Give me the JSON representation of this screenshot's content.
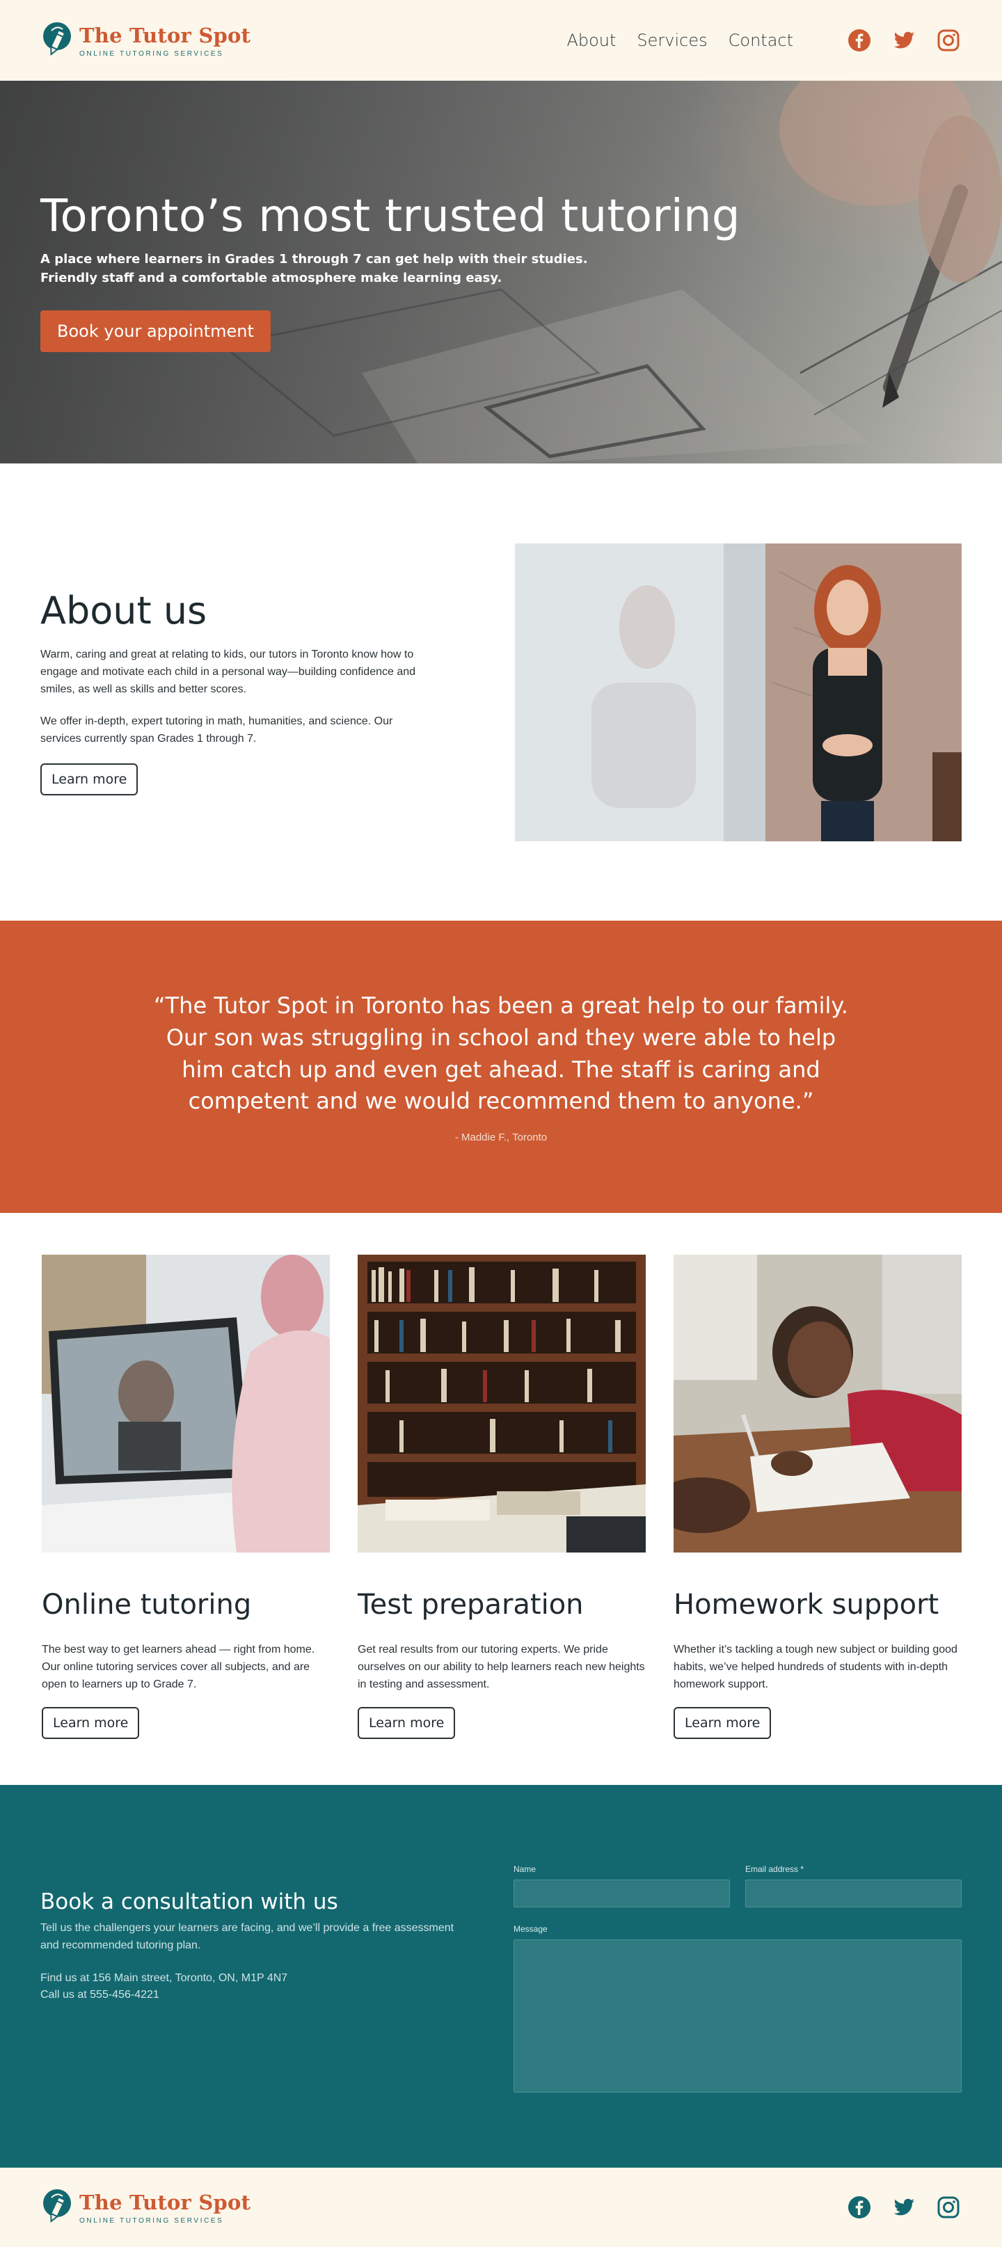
{
  "brand": {
    "name": "The Tutor Spot",
    "tagline": "ONLINE TUTORING SERVICES"
  },
  "nav": {
    "items": [
      "About",
      "Services",
      "Contact"
    ]
  },
  "social": [
    "facebook-icon",
    "twitter-icon",
    "instagram-icon"
  ],
  "colors": {
    "accent": "#cd5a33",
    "teal": "#136870",
    "cream": "#fdf6ea"
  },
  "hero": {
    "title": "Toronto’s most trusted tutoring",
    "subtitle_line1": "A place where learners in Grades 1 through 7 can get help with their studies.",
    "subtitle_line2": "Friendly staff and a comfortable atmosphere make learning easy.",
    "cta": "Book your appointment"
  },
  "about": {
    "title": "About us",
    "paragraph1": "Warm, caring and great at relating to kids, our tutors in Toronto know how to engage and motivate each child in a personal way—building confidence and smiles, as well as skills and better scores.",
    "paragraph2": "We offer in-depth, expert tutoring in math, humanities, and science. Our services currently span Grades 1 through 7.",
    "button": "Learn more"
  },
  "testimonial": {
    "quote": "“The Tutor Spot in Toronto has been a great help to our family. Our son was struggling in school and they were able to help him catch up and even get ahead. The staff is caring and competent and we would recommend them to anyone.”",
    "author": "- Maddie F., Toronto"
  },
  "services": [
    {
      "title": "Online tutoring",
      "text": "The best way to get learners ahead — right from home. Our online tutoring services cover all subjects, and are open to learners up to Grade 7.",
      "button": "Learn more"
    },
    {
      "title": "Test preparation",
      "text": "Get real results from our tutoring experts. We pride ourselves on our ability to help learners reach new heights in testing and assessment.",
      "button": "Learn more"
    },
    {
      "title": "Homework support",
      "text": "Whether it’s tackling a tough new subject or building good habits, we’ve helped hundreds of students with in-depth homework support.",
      "button": "Learn more"
    }
  ],
  "consultation": {
    "title": "Book a consultation with us",
    "text": "Tell us the challengers your learners are facing, and we’ll provide a free assessment and recommended tutoring plan.",
    "address": "Find us at 156 Main street, Toronto, ON, M1P 4N7",
    "phone": "Call us at 555-456-4221",
    "form": {
      "name_label": "Name",
      "email_label": "Email address *",
      "message_label": "Message"
    }
  }
}
